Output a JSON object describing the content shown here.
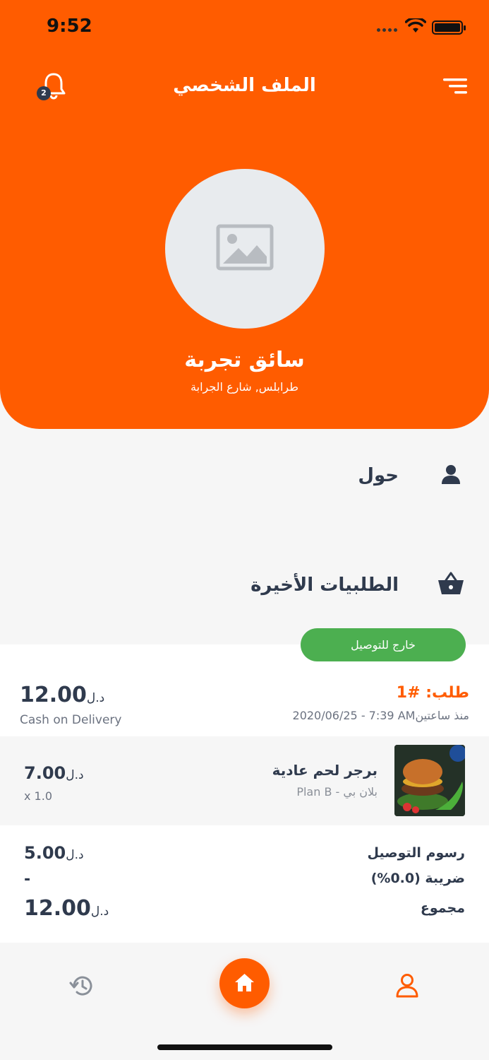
{
  "status_bar": {
    "time": "9:52"
  },
  "header": {
    "title": "الملف الشخصي",
    "notification_count": "2",
    "user_name": "سائق تجربة",
    "user_address": "طرابلس, شارع الجرابة"
  },
  "sections": {
    "about_label": "حول",
    "recent_orders_label": "الطلبيات الأخيرة"
  },
  "order": {
    "status": "خارج للتوصيل",
    "number": "طلب: #1",
    "date": "2020/06/25 - 7:39 AMمنذ ساعتين",
    "total": "12.00",
    "currency": "د.ل",
    "payment_method": "Cash on Delivery",
    "item": {
      "name": "برجر لحم عادية",
      "restaurant": "Plan B - بلان بي",
      "price": "7.00",
      "quantity": "x 1.0"
    },
    "summary": {
      "delivery_label": "رسوم التوصيل",
      "delivery_value": "5.00",
      "tax_label": "ضريبة (0.0%)",
      "tax_value": "-",
      "total_label": "مجموع",
      "total_value": "12.00"
    }
  },
  "bottom_nav": {
    "items": [
      "history-icon",
      "home-icon",
      "profile-icon"
    ],
    "active": "profile-icon"
  },
  "colors": {
    "accent": "#ff5c00",
    "dark": "#2f3a4d",
    "success": "#4caf50"
  }
}
